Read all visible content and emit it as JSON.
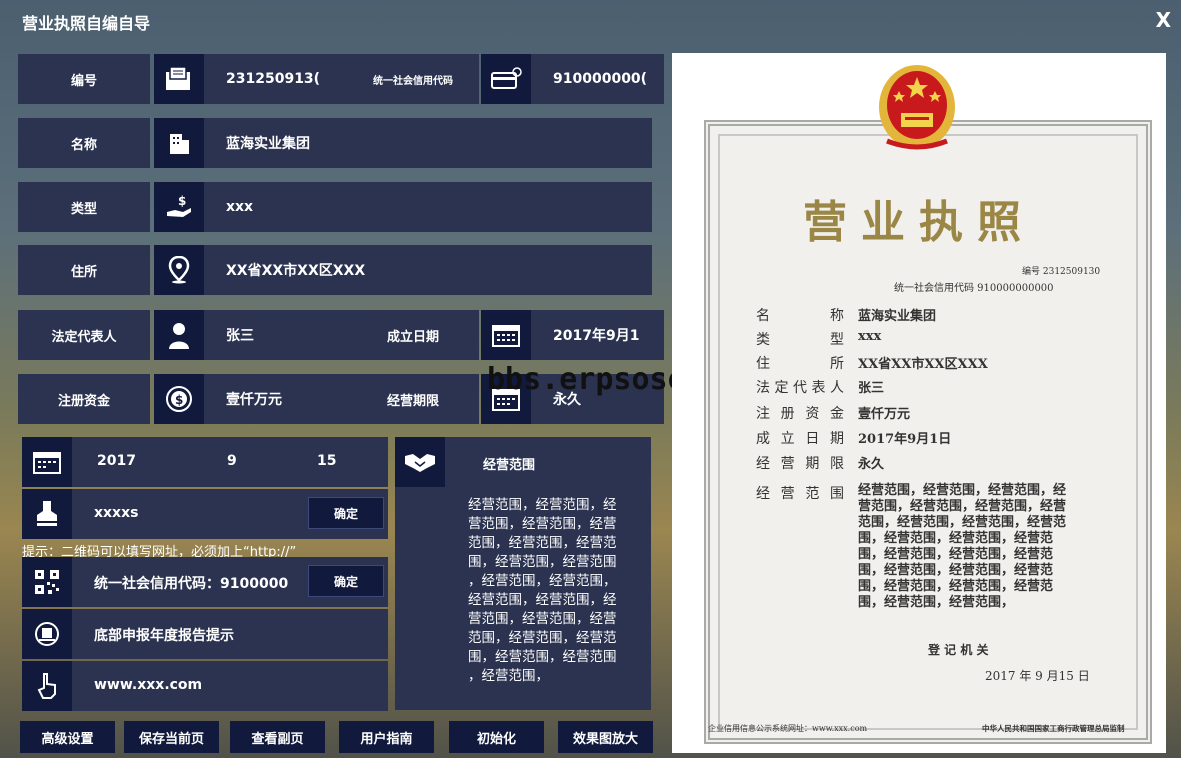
{
  "window": {
    "title": "营业执照自编自导",
    "close": "X"
  },
  "fields": {
    "number_label": "编号",
    "number_value": "231250913(",
    "credit_label": "统一社会信用代码",
    "credit_value": "910000000(",
    "name_label": "名称",
    "name_value": "蓝海实业集团",
    "type_label": "类型",
    "type_value": "xxx",
    "address_label": "住所",
    "address_value": "XX省XX市XX区XXX",
    "rep_label": "法定代表人",
    "rep_value": "张三",
    "found_label": "成立日期",
    "found_value": "2017年9月1",
    "capital_label": "注册资金",
    "capital_value": "壹仟万元",
    "term_label": "经营期限",
    "term_value": "永久"
  },
  "date_panel": {
    "year": "2017",
    "month": "9",
    "day": "15"
  },
  "seal_panel": {
    "value": "xxxxs",
    "confirm": "确定"
  },
  "hint": "提示：二维码可以填写网址，必须加上“http://”",
  "qr_panel": {
    "value": "统一社会信用代码：9100000",
    "confirm": "确定"
  },
  "notice_panel": {
    "value": "底部申报年度报告提示"
  },
  "url_panel": {
    "value": "www.xxx.com"
  },
  "scope_panel": {
    "title": "经营范围",
    "lines": [
      "经营范围，经营范围，经",
      "营范围，经营范围，经营",
      "范围，经营范围，经营范",
      "围，经营范围，经营范围",
      "，经营范围，经营范围，",
      "经营范围，经营范围，经",
      "营范围，经营范围，经营",
      "范围，经营范围，经营范",
      "围，经营范围，经营范围",
      "，经营范围，"
    ]
  },
  "bottom_buttons": [
    "高级设置",
    "保存当前页",
    "查看副页",
    "用户指南",
    "初始化",
    "效果图放大"
  ],
  "watermark": "bbs.erpsoso.cc",
  "certificate": {
    "title": "营业执照",
    "number_line": "编号 2312509130",
    "credit_line": "统一社会信用代码 910000000000",
    "rows": [
      {
        "name": "名称",
        "value": "蓝海实业集团"
      },
      {
        "name": "类型",
        "value": "xxx"
      },
      {
        "name": "住所",
        "value": "XX省XX市XX区XXX"
      },
      {
        "name": "法定代表人",
        "value": "张三"
      },
      {
        "name": "注册资金",
        "value": "壹仟万元"
      },
      {
        "name": "成立日期",
        "value": "2017年9月1日"
      },
      {
        "name": "经营期限",
        "value": "永久"
      },
      {
        "name": "经营范围",
        "value": ""
      }
    ],
    "scope_lines": [
      "经营范围，经营范围，经营范围，经",
      "营范围，经营范围，经营范围，经营",
      "范围，经营范围，经营范围，经营范",
      "围，经营范围，经营范围，经营范",
      "围，经营范围，经营范围，经营范",
      "围，经营范围，经营范围，经营范",
      "围，经营范围，经营范围，经营范",
      "围，经营范围，经营范围，"
    ],
    "authority": "登 记 机 关",
    "issue_date": "2017 年  9  月15 日",
    "footer_left": "企业信用信息公示系统网址：www.xxx.com",
    "footer_right": "中华人民共和国国家工商行政管理总局监制"
  },
  "colors": {
    "label_bg": "#2b3350",
    "icon_bg": "#111a3d",
    "cert_gold": "#9a8645"
  }
}
